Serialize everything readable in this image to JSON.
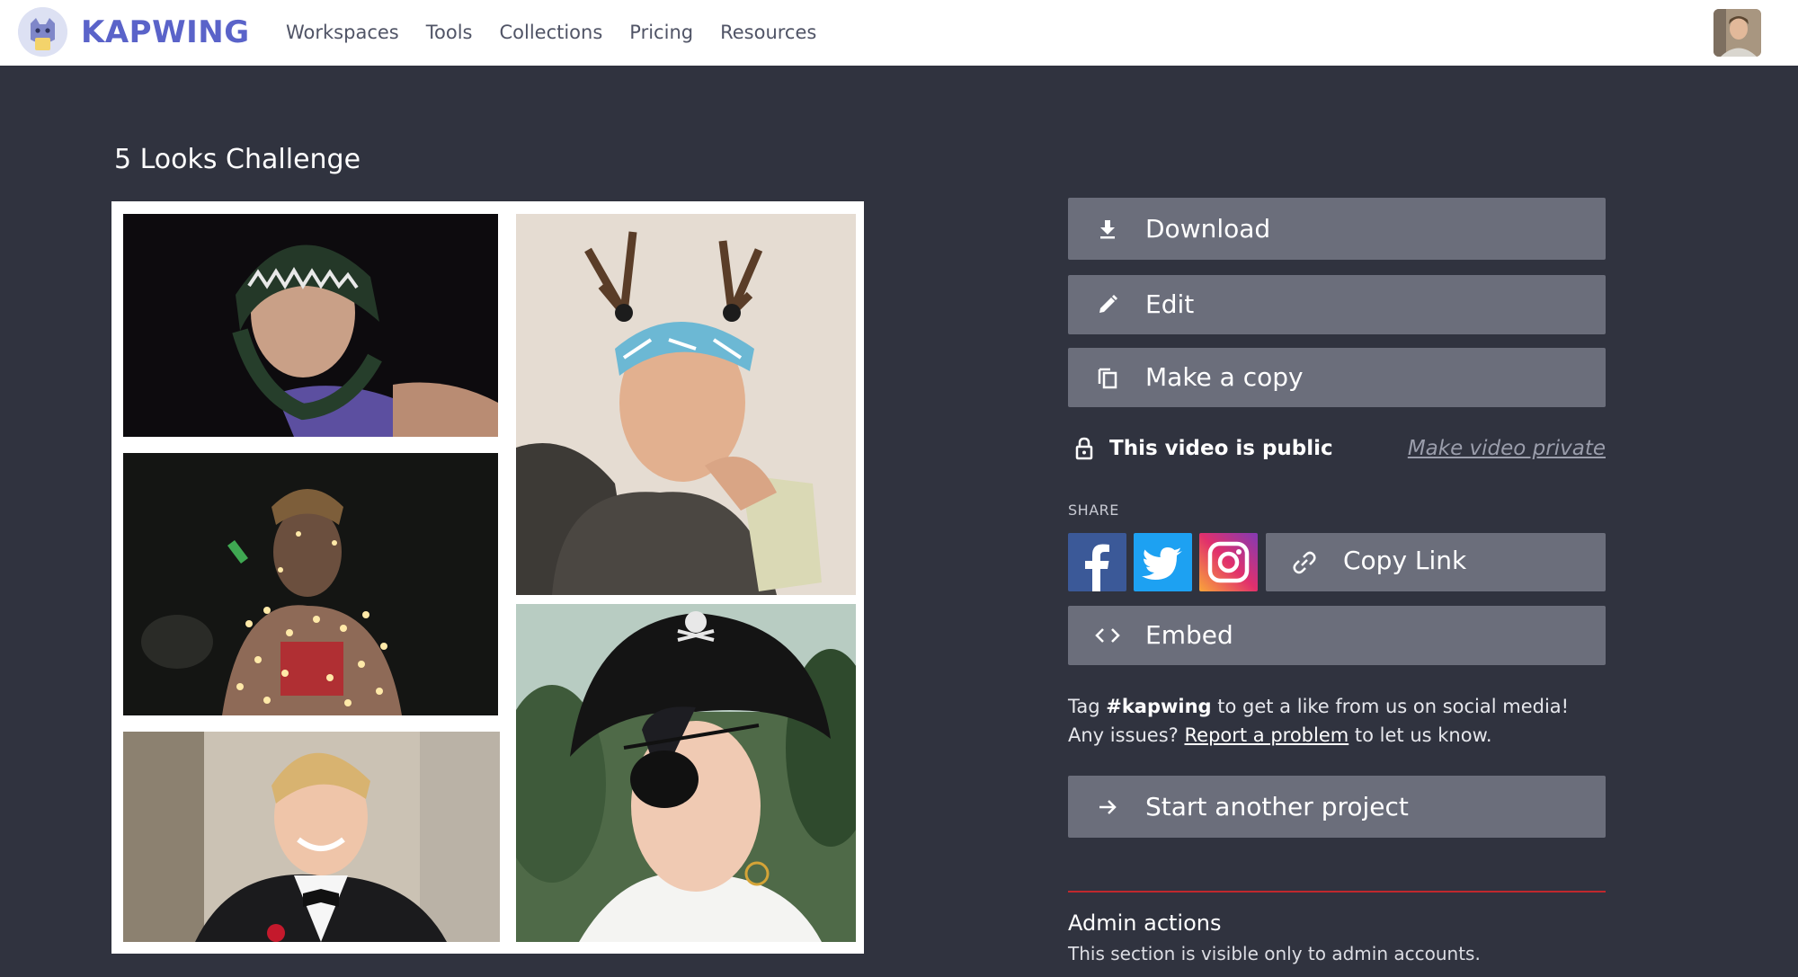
{
  "header": {
    "logo_text": "KAPWING",
    "nav": [
      "Workspaces",
      "Tools",
      "Collections",
      "Pricing",
      "Resources"
    ]
  },
  "page": {
    "title": "5 Looks Challenge"
  },
  "actions": {
    "download": "Download",
    "edit": "Edit",
    "make_copy": "Make a copy",
    "embed": "Embed",
    "start_another": "Start another project"
  },
  "visibility": {
    "status": "This video is public",
    "toggle_link": "Make video private"
  },
  "share": {
    "label": "SHARE",
    "copy_link": "Copy Link",
    "networks": [
      "facebook-icon",
      "twitter-icon",
      "instagram-icon"
    ]
  },
  "tag_message": {
    "prefix": "Tag ",
    "hashtag": "#kapwing",
    "middle": " to get a like from us on social media! Any issues? ",
    "report_link": "Report a problem",
    "suffix": " to let us know."
  },
  "admin": {
    "title": "Admin actions",
    "description": "This section is visible only to admin accounts."
  },
  "colors": {
    "background": "#30333f",
    "button": "#6b6e7b",
    "brand": "#5a63c9",
    "divider": "#c0282d",
    "facebook": "#3b5998",
    "twitter": "#1da1f2"
  }
}
